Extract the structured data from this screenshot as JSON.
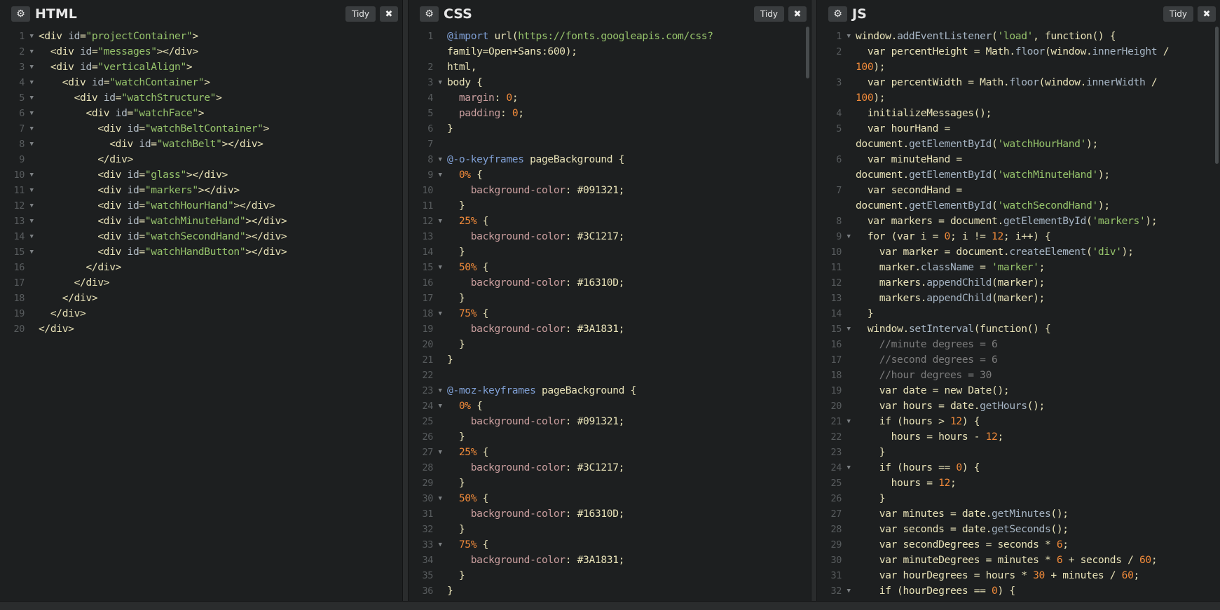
{
  "panels": {
    "html": {
      "title": "HTML",
      "tidy": "Tidy",
      "close": "✖",
      "gear": "⚙"
    },
    "css": {
      "title": "CSS",
      "tidy": "Tidy",
      "close": "✖",
      "gear": "⚙"
    },
    "js": {
      "title": "JS",
      "tidy": "Tidy",
      "close": "✖",
      "gear": "⚙"
    }
  },
  "html_lines": [
    {
      "n": "1",
      "fold": true,
      "code": "<div id=\"projectContainer\">"
    },
    {
      "n": "2",
      "fold": true,
      "code": "  <div id=\"messages\"></div>"
    },
    {
      "n": "3",
      "fold": true,
      "code": "  <div id=\"verticalAlign\">"
    },
    {
      "n": "4",
      "fold": true,
      "code": "    <div id=\"watchContainer\">"
    },
    {
      "n": "5",
      "fold": true,
      "code": "      <div id=\"watchStructure\">"
    },
    {
      "n": "6",
      "fold": true,
      "code": "        <div id=\"watchFace\">"
    },
    {
      "n": "7",
      "fold": true,
      "code": "          <div id=\"watchBeltContainer\">"
    },
    {
      "n": "8",
      "fold": true,
      "code": "            <div id=\"watchBelt\"></div>"
    },
    {
      "n": "9",
      "fold": false,
      "code": "          </div>"
    },
    {
      "n": "10",
      "fold": true,
      "code": "          <div id=\"glass\"></div>"
    },
    {
      "n": "11",
      "fold": true,
      "code": "          <div id=\"markers\"></div>"
    },
    {
      "n": "12",
      "fold": true,
      "code": "          <div id=\"watchHourHand\"></div>"
    },
    {
      "n": "13",
      "fold": true,
      "code": "          <div id=\"watchMinuteHand\"></div>"
    },
    {
      "n": "14",
      "fold": true,
      "code": "          <div id=\"watchSecondHand\"></div>"
    },
    {
      "n": "15",
      "fold": true,
      "code": "          <div id=\"watchHandButton\"></div>"
    },
    {
      "n": "16",
      "fold": false,
      "code": "        </div>"
    },
    {
      "n": "17",
      "fold": false,
      "code": "      </div>"
    },
    {
      "n": "18",
      "fold": false,
      "code": "    </div>"
    },
    {
      "n": "19",
      "fold": false,
      "code": "  </div>"
    },
    {
      "n": "20",
      "fold": false,
      "code": "</div>"
    }
  ],
  "css_lines": [
    {
      "n": "1",
      "fold": false,
      "code": "@import url(https://fonts.googleapis.com/css?"
    },
    {
      "n": "",
      "fold": false,
      "code": "family=Open+Sans:600);"
    },
    {
      "n": "2",
      "fold": false,
      "code": "html,"
    },
    {
      "n": "3",
      "fold": true,
      "code": "body {"
    },
    {
      "n": "4",
      "fold": false,
      "code": "  margin: 0;"
    },
    {
      "n": "5",
      "fold": false,
      "code": "  padding: 0;"
    },
    {
      "n": "6",
      "fold": false,
      "code": "}"
    },
    {
      "n": "7",
      "fold": false,
      "code": ""
    },
    {
      "n": "8",
      "fold": true,
      "code": "@-o-keyframes pageBackground {"
    },
    {
      "n": "9",
      "fold": true,
      "code": "  0% {"
    },
    {
      "n": "10",
      "fold": false,
      "code": "    background-color: #091321;"
    },
    {
      "n": "11",
      "fold": false,
      "code": "  }"
    },
    {
      "n": "12",
      "fold": true,
      "code": "  25% {"
    },
    {
      "n": "13",
      "fold": false,
      "code": "    background-color: #3C1217;"
    },
    {
      "n": "14",
      "fold": false,
      "code": "  }"
    },
    {
      "n": "15",
      "fold": true,
      "code": "  50% {"
    },
    {
      "n": "16",
      "fold": false,
      "code": "    background-color: #16310D;"
    },
    {
      "n": "17",
      "fold": false,
      "code": "  }"
    },
    {
      "n": "18",
      "fold": true,
      "code": "  75% {"
    },
    {
      "n": "19",
      "fold": false,
      "code": "    background-color: #3A1831;"
    },
    {
      "n": "20",
      "fold": false,
      "code": "  }"
    },
    {
      "n": "21",
      "fold": false,
      "code": "}"
    },
    {
      "n": "22",
      "fold": false,
      "code": ""
    },
    {
      "n": "23",
      "fold": true,
      "code": "@-moz-keyframes pageBackground {"
    },
    {
      "n": "24",
      "fold": true,
      "code": "  0% {"
    },
    {
      "n": "25",
      "fold": false,
      "code": "    background-color: #091321;"
    },
    {
      "n": "26",
      "fold": false,
      "code": "  }"
    },
    {
      "n": "27",
      "fold": true,
      "code": "  25% {"
    },
    {
      "n": "28",
      "fold": false,
      "code": "    background-color: #3C1217;"
    },
    {
      "n": "29",
      "fold": false,
      "code": "  }"
    },
    {
      "n": "30",
      "fold": true,
      "code": "  50% {"
    },
    {
      "n": "31",
      "fold": false,
      "code": "    background-color: #16310D;"
    },
    {
      "n": "32",
      "fold": false,
      "code": "  }"
    },
    {
      "n": "33",
      "fold": true,
      "code": "  75% {"
    },
    {
      "n": "34",
      "fold": false,
      "code": "    background-color: #3A1831;"
    },
    {
      "n": "35",
      "fold": false,
      "code": "  }"
    },
    {
      "n": "36",
      "fold": false,
      "code": "}"
    }
  ],
  "js_lines": [
    {
      "n": "1",
      "fold": true,
      "code": "window.addEventListener('load', function() {"
    },
    {
      "n": "2",
      "fold": false,
      "code": "  var percentHeight = Math.floor(window.innerHeight /"
    },
    {
      "n": "",
      "fold": false,
      "code": "100);"
    },
    {
      "n": "3",
      "fold": false,
      "code": "  var percentWidth = Math.floor(window.innerWidth /"
    },
    {
      "n": "",
      "fold": false,
      "code": "100);"
    },
    {
      "n": "4",
      "fold": false,
      "code": "  initializeMessages();"
    },
    {
      "n": "5",
      "fold": false,
      "code": "  var hourHand ="
    },
    {
      "n": "",
      "fold": false,
      "code": "document.getElementById('watchHourHand');"
    },
    {
      "n": "6",
      "fold": false,
      "code": "  var minuteHand ="
    },
    {
      "n": "",
      "fold": false,
      "code": "document.getElementById('watchMinuteHand');"
    },
    {
      "n": "7",
      "fold": false,
      "code": "  var secondHand ="
    },
    {
      "n": "",
      "fold": false,
      "code": "document.getElementById('watchSecondHand');"
    },
    {
      "n": "8",
      "fold": false,
      "code": "  var markers = document.getElementById('markers');"
    },
    {
      "n": "9",
      "fold": true,
      "code": "  for (var i = 0; i != 12; i++) {"
    },
    {
      "n": "10",
      "fold": false,
      "code": "    var marker = document.createElement('div');"
    },
    {
      "n": "11",
      "fold": false,
      "code": "    marker.className = 'marker';"
    },
    {
      "n": "12",
      "fold": false,
      "code": "    markers.appendChild(marker);"
    },
    {
      "n": "13",
      "fold": false,
      "code": "    markers.appendChild(marker);"
    },
    {
      "n": "14",
      "fold": false,
      "code": "  }"
    },
    {
      "n": "15",
      "fold": true,
      "code": "  window.setInterval(function() {"
    },
    {
      "n": "16",
      "fold": false,
      "code": "    //minute degrees = 6"
    },
    {
      "n": "17",
      "fold": false,
      "code": "    //second degrees = 6"
    },
    {
      "n": "18",
      "fold": false,
      "code": "    //hour degrees = 30"
    },
    {
      "n": "19",
      "fold": false,
      "code": "    var date = new Date();"
    },
    {
      "n": "20",
      "fold": false,
      "code": "    var hours = date.getHours();"
    },
    {
      "n": "21",
      "fold": true,
      "code": "    if (hours > 12) {"
    },
    {
      "n": "22",
      "fold": false,
      "code": "      hours = hours - 12;"
    },
    {
      "n": "23",
      "fold": false,
      "code": "    }"
    },
    {
      "n": "24",
      "fold": true,
      "code": "    if (hours == 0) {"
    },
    {
      "n": "25",
      "fold": false,
      "code": "      hours = 12;"
    },
    {
      "n": "26",
      "fold": false,
      "code": "    }"
    },
    {
      "n": "27",
      "fold": false,
      "code": "    var minutes = date.getMinutes();"
    },
    {
      "n": "28",
      "fold": false,
      "code": "    var seconds = date.getSeconds();"
    },
    {
      "n": "29",
      "fold": false,
      "code": "    var secondDegrees = seconds * 6;"
    },
    {
      "n": "30",
      "fold": false,
      "code": "    var minuteDegrees = minutes * 6 + seconds / 60;"
    },
    {
      "n": "31",
      "fold": false,
      "code": "    var hourDegrees = hours * 30 + minutes / 60;"
    },
    {
      "n": "32",
      "fold": true,
      "code": "    if (hourDegrees == 0) {"
    }
  ]
}
